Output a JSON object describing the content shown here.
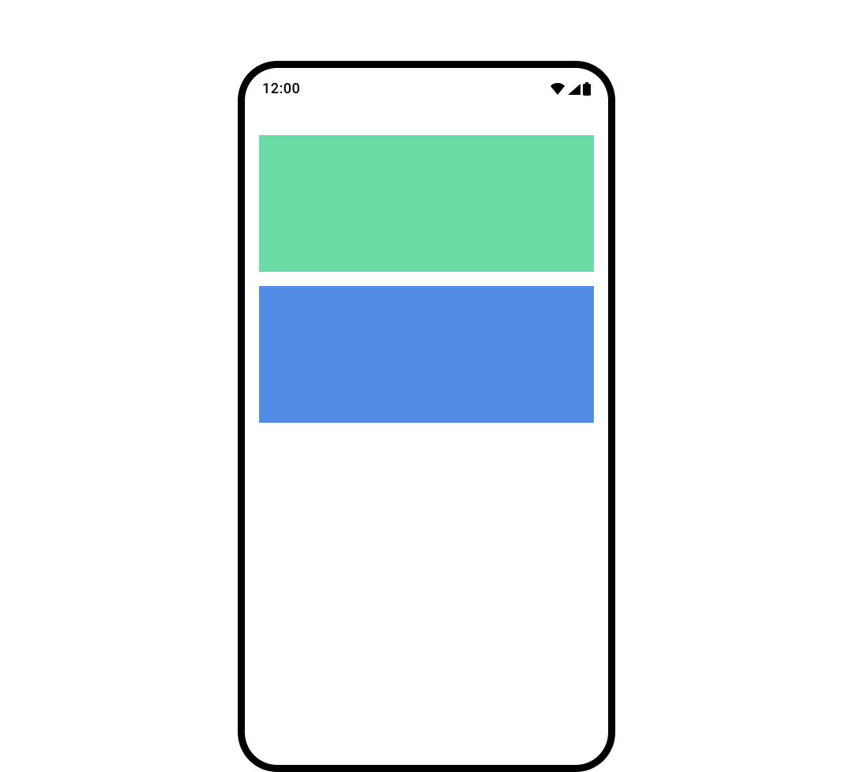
{
  "status_bar": {
    "time": "12:00",
    "icons": {
      "wifi": "wifi-icon",
      "signal": "signal-icon",
      "battery": "battery-icon"
    }
  },
  "content": {
    "block1_color": "#6BDCA5",
    "block2_color": "#528CE7"
  }
}
